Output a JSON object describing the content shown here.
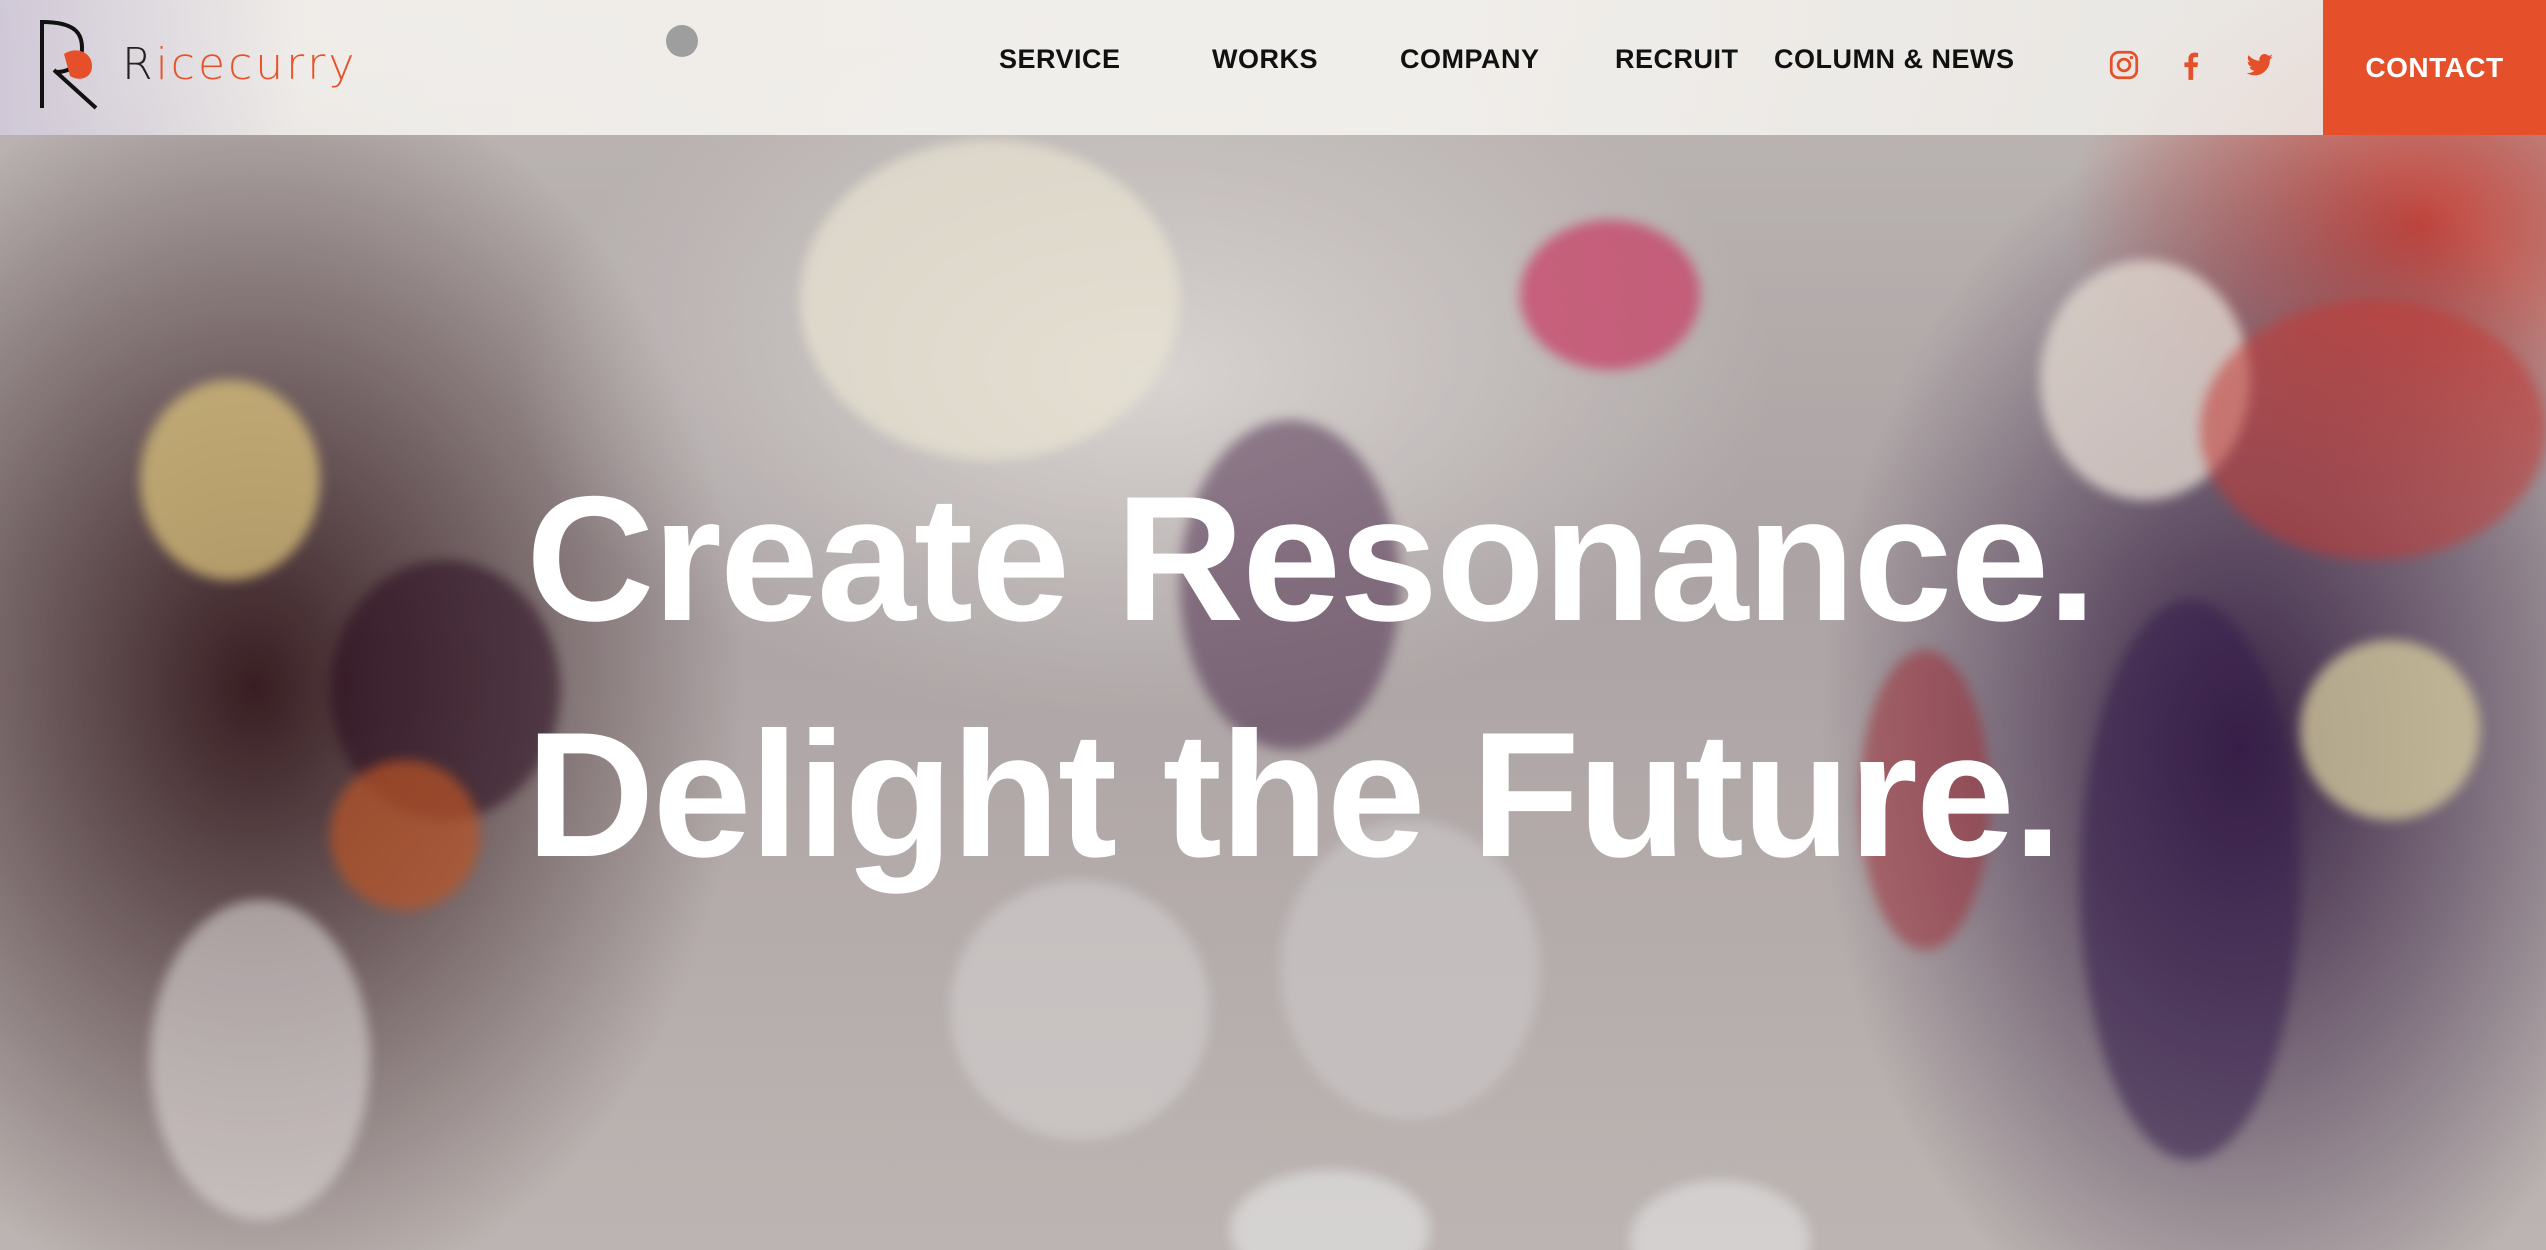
{
  "brand": {
    "logo_initial": "R",
    "logo_rest": "icecurry",
    "accent_color": "#e5502a"
  },
  "nav": {
    "items": [
      {
        "label": "SERVICE"
      },
      {
        "label": "WORKS"
      },
      {
        "label": "COMPANY"
      },
      {
        "label": "RECRUIT"
      },
      {
        "label": "COLUMN & NEWS"
      }
    ]
  },
  "social": [
    {
      "icon": "instagram-icon"
    },
    {
      "icon": "facebook-icon"
    },
    {
      "icon": "twitter-icon"
    }
  ],
  "contact": {
    "label": "CONTACT"
  },
  "hero": {
    "line1": "Create Resonance.",
    "line2": "Delight the Future."
  }
}
